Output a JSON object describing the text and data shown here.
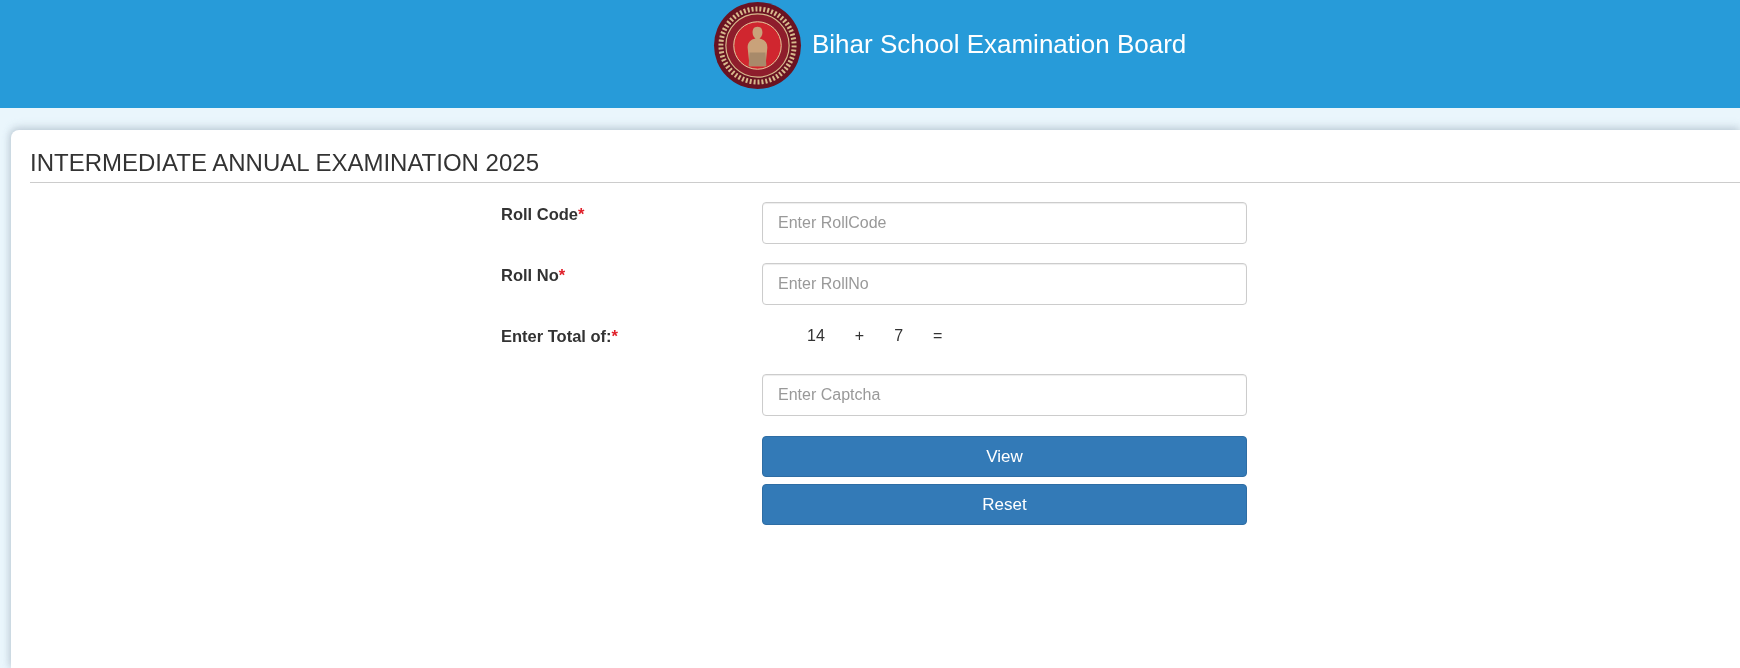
{
  "header": {
    "title": "Bihar School Examination Board"
  },
  "card": {
    "title": "INTERMEDIATE ANNUAL EXAMINATION 2025"
  },
  "form": {
    "rows": [
      {
        "kind": "input",
        "label": "Roll Code",
        "mark": "*",
        "placeholder": "Enter RollCode"
      },
      {
        "kind": "input",
        "label": "Roll No",
        "mark": "*",
        "placeholder": "Enter RollNo"
      },
      {
        "kind": "sum",
        "label": "Enter Total of:",
        "mark": "*",
        "terms": [
          "14",
          "+",
          "7",
          "="
        ]
      },
      {
        "kind": "input",
        "placeholder": "Enter Captcha"
      }
    ],
    "buttons": [
      "View",
      "Reset"
    ]
  }
}
